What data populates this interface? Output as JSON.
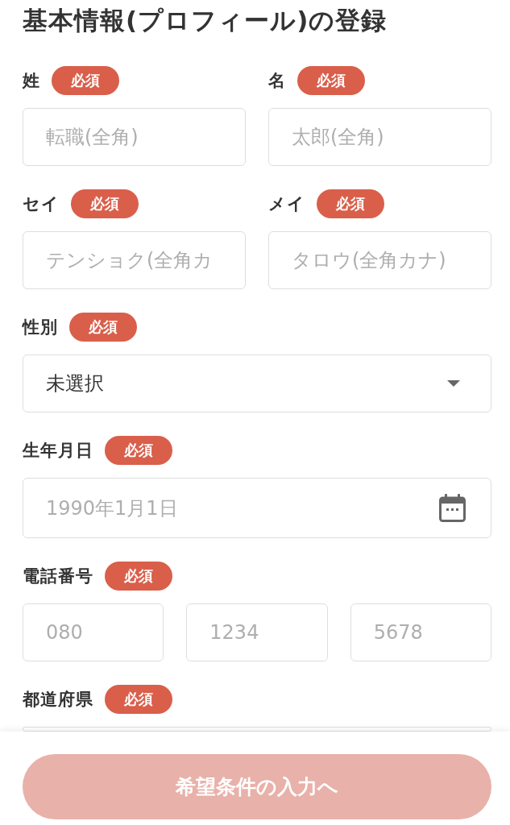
{
  "title": "基本情報(プロフィール)の登録",
  "rows": [
    [
      {
        "label": "姓",
        "badge": "必須",
        "fields": [
          {
            "kind": "text",
            "placeholder": "転職(全角)"
          }
        ]
      },
      {
        "label": "名",
        "badge": "必須",
        "fields": [
          {
            "kind": "text",
            "placeholder": "太郎(全角)"
          }
        ]
      }
    ],
    [
      {
        "label": "セイ",
        "badge": "必須",
        "fields": [
          {
            "kind": "text",
            "placeholder": "テンショク(全角カ"
          }
        ]
      },
      {
        "label": "メイ",
        "badge": "必須",
        "fields": [
          {
            "kind": "text",
            "placeholder": "タロウ(全角カナ)"
          }
        ]
      }
    ],
    [
      {
        "label": "性別",
        "badge": "必須",
        "fields": [
          {
            "kind": "select",
            "value": "未選択"
          }
        ]
      }
    ],
    [
      {
        "label": "生年月日",
        "badge": "必須",
        "fields": [
          {
            "kind": "date",
            "placeholder": "1990年1月1日"
          }
        ]
      }
    ],
    [
      {
        "label": "電話番号",
        "badge": "必須",
        "fields": [
          {
            "kind": "text",
            "placeholder": "080"
          },
          {
            "kind": "text",
            "placeholder": "1234"
          },
          {
            "kind": "text",
            "placeholder": "5678"
          }
        ]
      }
    ],
    [
      {
        "label": "都道府県",
        "badge": "必須",
        "fields": [
          {
            "kind": "select"
          }
        ]
      }
    ]
  ],
  "footer": {
    "button": {
      "label": "希望条件の入力へ",
      "disabled": true
    }
  }
}
